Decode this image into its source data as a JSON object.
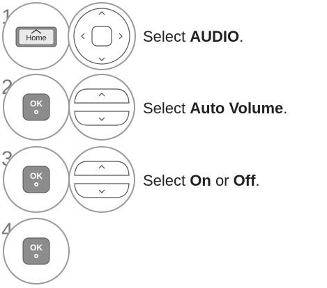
{
  "steps": [
    {
      "number": "1",
      "button_label": "Home",
      "button_icon": "home-icon",
      "control": "dpad",
      "text_before": "Select ",
      "text_bold": "AUDIO",
      "text_after": "."
    },
    {
      "number": "2",
      "button_label": "OK",
      "control": "updown",
      "text_before": "Select ",
      "text_bold": "Auto Volume",
      "text_after": "."
    },
    {
      "number": "3",
      "button_label": "OK",
      "control": "updown",
      "text_before": "Select ",
      "text_bold": "On",
      "text_mid": " or ",
      "text_bold2": "Off",
      "text_after": "."
    },
    {
      "number": "4",
      "button_label": "OK",
      "control": "none"
    }
  ],
  "colors": {
    "circle_stroke": "#9a9a9a",
    "button_fill": "#8c8c8c",
    "button_light": "#e9e9e9",
    "text": "#222222",
    "step_number": "#7a7a7a"
  }
}
